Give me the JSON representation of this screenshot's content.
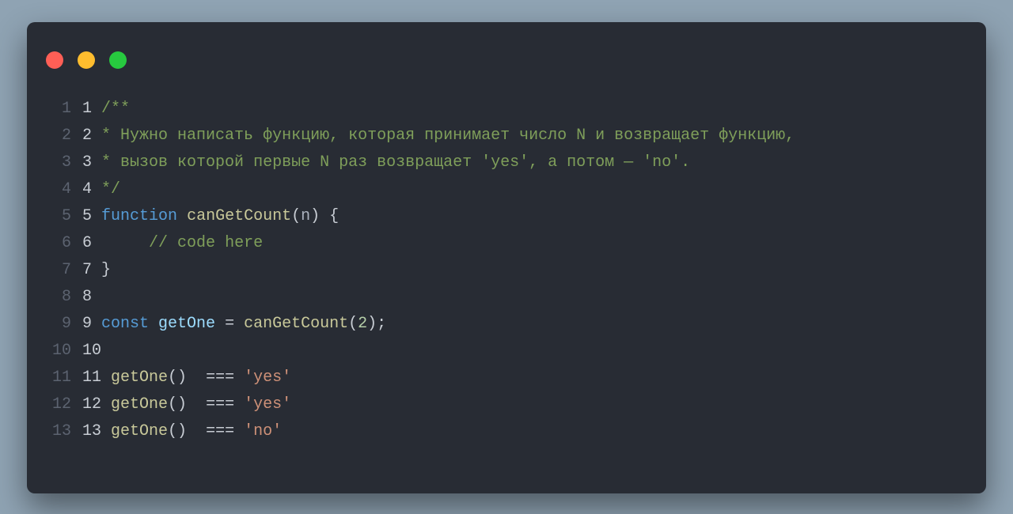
{
  "window": {
    "dots": [
      "red",
      "yellow",
      "green"
    ]
  },
  "code": {
    "lines": [
      {
        "n": "1",
        "m": "1",
        "tokens": [
          [
            "cmt",
            "/**"
          ]
        ]
      },
      {
        "n": "2",
        "m": "2",
        "tokens": [
          [
            "cmt",
            "* Нужно написать функцию, которая принимает число N и возвращает функцию,"
          ]
        ]
      },
      {
        "n": "3",
        "m": "3",
        "tokens": [
          [
            "cmt",
            "* вызов которой первые N раз возвращает 'yes', а потом — 'no'."
          ]
        ]
      },
      {
        "n": "4",
        "m": "4",
        "tokens": [
          [
            "cmt",
            "*/"
          ]
        ]
      },
      {
        "n": "5",
        "m": "5",
        "tokens": [
          [
            "kw",
            "function "
          ],
          [
            "fn",
            "canGetCount"
          ],
          [
            "pn",
            "("
          ],
          [
            "nm",
            "n"
          ],
          [
            "pn",
            ") {"
          ]
        ]
      },
      {
        "n": "6",
        "m": "6",
        "tokens": [
          [
            "pn",
            "     "
          ],
          [
            "cmt",
            "// code here"
          ]
        ]
      },
      {
        "n": "7",
        "m": "7",
        "tokens": [
          [
            "pn",
            "}"
          ]
        ]
      },
      {
        "n": "8",
        "m": "8",
        "tokens": [
          [
            "pn",
            ""
          ]
        ]
      },
      {
        "n": "9",
        "m": "9",
        "tokens": [
          [
            "const",
            "const "
          ],
          [
            "ident",
            "getOne"
          ],
          [
            "op",
            " = "
          ],
          [
            "fn",
            "canGetCount"
          ],
          [
            "pn",
            "("
          ],
          [
            "num",
            "2"
          ],
          [
            "pn",
            ");"
          ]
        ]
      },
      {
        "n": "10",
        "m": "10",
        "tokens": [
          [
            "pn",
            ""
          ]
        ]
      },
      {
        "n": "11",
        "m": "11",
        "tokens": [
          [
            "fn",
            "getOne"
          ],
          [
            "pn",
            "()  "
          ],
          [
            "op",
            "=== "
          ],
          [
            "str",
            "'yes'"
          ]
        ]
      },
      {
        "n": "12",
        "m": "12",
        "tokens": [
          [
            "fn",
            "getOne"
          ],
          [
            "pn",
            "()  "
          ],
          [
            "op",
            "=== "
          ],
          [
            "str",
            "'yes'"
          ]
        ]
      },
      {
        "n": "13",
        "m": "13",
        "tokens": [
          [
            "fn",
            "getOne"
          ],
          [
            "pn",
            "()  "
          ],
          [
            "op",
            "=== "
          ],
          [
            "str",
            "'no'"
          ]
        ]
      }
    ]
  }
}
